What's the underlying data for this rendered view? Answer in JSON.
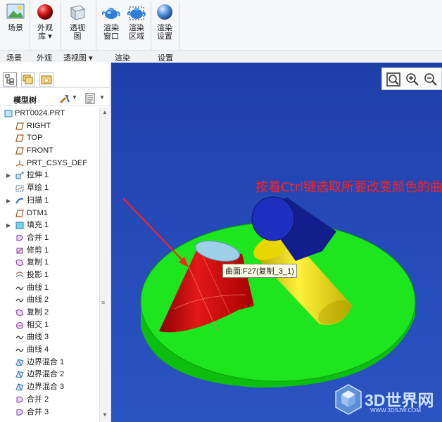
{
  "ribbon": {
    "buttons": {
      "scene": "场景",
      "appearance": "外观\n库 ▾",
      "perspective": "透视\n图",
      "render_window": "渲染\n窗口",
      "render_region": "渲染\n区域",
      "render_setup": "渲染\n设置"
    },
    "groups": {
      "scene": "场景",
      "appearance": "外观",
      "perspective": "透视图 ▾",
      "render": "渲染",
      "setup": "设置"
    }
  },
  "model_tree": {
    "title": "模型树",
    "items": [
      {
        "label": "PRT0024.PRT",
        "icon": "part-icon",
        "expandable": false
      },
      {
        "label": "RIGHT",
        "icon": "datum-plane-icon",
        "expandable": false
      },
      {
        "label": "TOP",
        "icon": "datum-plane-icon",
        "expandable": false
      },
      {
        "label": "FRONT",
        "icon": "datum-plane-icon",
        "expandable": false
      },
      {
        "label": "PRT_CSYS_DEF",
        "icon": "csys-icon",
        "expandable": false
      },
      {
        "label": "拉伸 1",
        "icon": "extrude-icon",
        "expandable": true
      },
      {
        "label": "草绘 1",
        "icon": "sketch-icon",
        "expandable": false
      },
      {
        "label": "扫描 1",
        "icon": "sweep-icon",
        "expandable": true
      },
      {
        "label": "DTM1",
        "icon": "datum-plane-icon",
        "expandable": false
      },
      {
        "label": "填充 1",
        "icon": "fill-icon",
        "expandable": true
      },
      {
        "label": "合并 1",
        "icon": "merge-icon",
        "expandable": false
      },
      {
        "label": "修剪 1",
        "icon": "trim-icon",
        "expandable": false
      },
      {
        "label": "复制 1",
        "icon": "copy-icon",
        "expandable": false
      },
      {
        "label": "投影 1",
        "icon": "project-icon",
        "expandable": false
      },
      {
        "label": "曲线 1",
        "icon": "curve-icon",
        "expandable": false
      },
      {
        "label": "曲线 2",
        "icon": "curve-icon",
        "expandable": false
      },
      {
        "label": "复制 2",
        "icon": "copy-icon",
        "expandable": false
      },
      {
        "label": "相交 1",
        "icon": "intersect-icon",
        "expandable": false
      },
      {
        "label": "曲线 3",
        "icon": "curve-icon",
        "expandable": false
      },
      {
        "label": "曲线 4",
        "icon": "curve-icon",
        "expandable": false
      },
      {
        "label": "边界混合 1",
        "icon": "boundary-blend-icon",
        "expandable": false
      },
      {
        "label": "边界混合 2",
        "icon": "boundary-blend-icon",
        "expandable": false
      },
      {
        "label": "边界混合 3",
        "icon": "boundary-blend-icon",
        "expandable": false
      },
      {
        "label": "合并 2",
        "icon": "merge-icon",
        "expandable": false
      },
      {
        "label": "合并 3",
        "icon": "merge-icon",
        "expandable": false
      }
    ]
  },
  "viewport": {
    "annotation": "按着Ctrl键选取所要改变颜色的曲面",
    "tooltip": "曲面:F27(复制_3_1)",
    "watermark_title": "3D世界网",
    "watermark_url": "WWW.3DSJW.COM",
    "colors": {
      "background": "#2449b6",
      "disk": "#1ee61e",
      "cone": "#d01010",
      "yellow_cylinder": "#f0e000",
      "blue_cylinder": "#1a2ab0",
      "annotation": "#ff2020"
    }
  }
}
